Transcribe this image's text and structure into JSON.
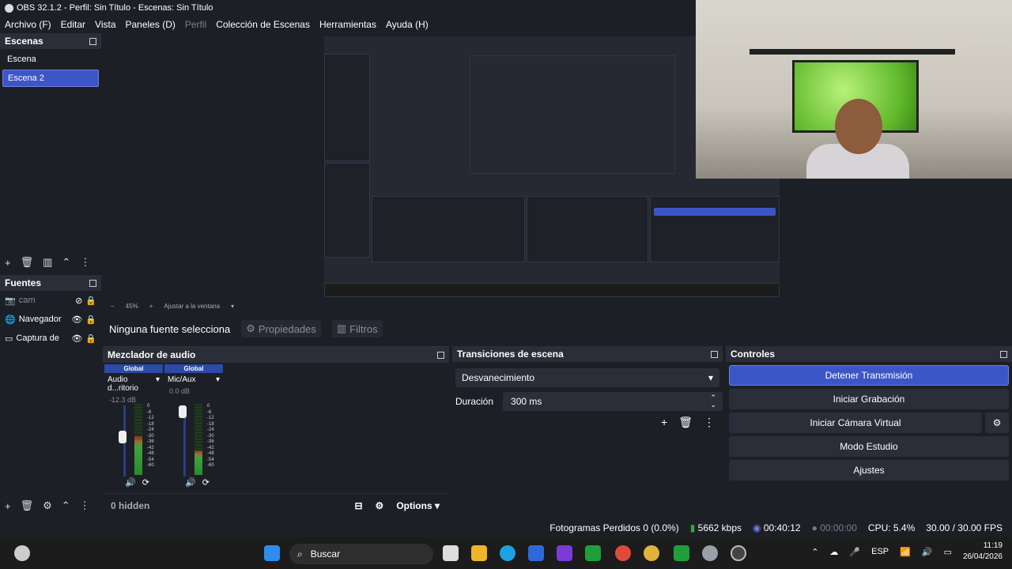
{
  "window": {
    "title": "OBS 32.1.2 - Perfil: Sin Título - Escenas: Sin Título"
  },
  "menu": [
    "Archivo (F)",
    "Editar",
    "Vista",
    "Paneles (D)",
    "Perfil",
    "Colección de Escenas",
    "Herramientas",
    "Ayuda (H)"
  ],
  "scenes": {
    "title": "Escenas",
    "items": [
      "Escena",
      "Escena 2"
    ]
  },
  "sources": {
    "title": "Fuentes",
    "items": [
      {
        "name": "cam"
      },
      {
        "name": "Navegador"
      },
      {
        "name": "Captura de"
      }
    ]
  },
  "zoom": {
    "level": "45%",
    "fit": "Ajustar a la ventana"
  },
  "context": {
    "no_source": "Ninguna fuente selecciona",
    "properties": "Propiedades",
    "filters": "Filtros"
  },
  "mixer": {
    "title": "Mezclador de audio",
    "channels": [
      {
        "badge": "Global",
        "name": "Audio d...ritorio",
        "db": "-12.3 dB",
        "level": 0.55,
        "fader": 0.6
      },
      {
        "badge": "Global",
        "name": "Mic/Aux",
        "db": "0.0 dB",
        "level": 0.35,
        "fader": 1.0
      }
    ],
    "scale": [
      "0",
      "-6",
      "-12",
      "-18",
      "-24",
      "-30",
      "-36",
      "-42",
      "-48",
      "-54",
      "-60"
    ],
    "hidden": "0 hidden",
    "options": "Options"
  },
  "transitions": {
    "title": "Transiciones de escena",
    "selected": "Desvanecimiento",
    "duration_label": "Duración",
    "duration_value": "300 ms"
  },
  "controls": {
    "title": "Controles",
    "stop_stream": "Detener Transmisión",
    "start_record": "Iniciar Grabación",
    "virtual_cam": "Iniciar Cámara Virtual",
    "studio_mode": "Modo Estudio",
    "settings": "Ajustes"
  },
  "status": {
    "dropped": "Fotogramas Perdidos 0 (0.0%)",
    "bitrate": "5662 kbps",
    "stream_time": "00:40:12",
    "record_time": "00:00:00",
    "cpu": "CPU: 5.4%",
    "fps": "30.00 / 30.00 FPS"
  },
  "taskbar": {
    "search": "Buscar",
    "lang": "ESP",
    "time": "11:19",
    "date": "26/04/2026"
  },
  "colors": {
    "accent": "#3d56c7",
    "bg": "#1d1f26"
  }
}
